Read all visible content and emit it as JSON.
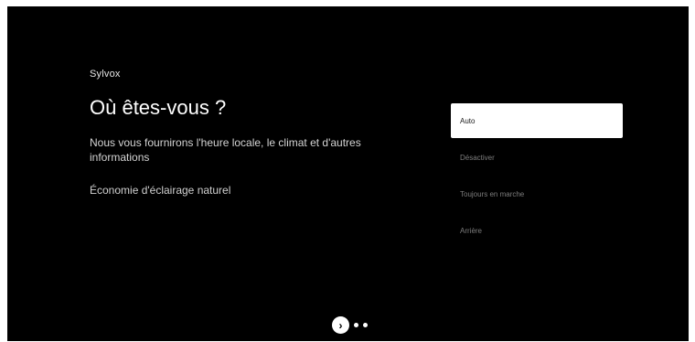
{
  "brand": "Sylvox",
  "title": "Où êtes-vous ?",
  "description": "Nous vous fournirons l'heure locale, le climat et d'autres informations",
  "sub_setting": "Économie d'éclairage naturel",
  "options": [
    {
      "label": "Auto",
      "selected": true
    },
    {
      "label": "Désactiver",
      "selected": false
    },
    {
      "label": "Toujours en marche",
      "selected": false
    },
    {
      "label": "Arrière",
      "selected": false
    }
  ],
  "pager": {
    "next_icon": "chevron-right-icon",
    "next_glyph": "›",
    "dots": 2
  },
  "colors": {
    "background": "#000000",
    "selected_option_bg": "#ffffff",
    "option_text": "#7d7d7d"
  }
}
